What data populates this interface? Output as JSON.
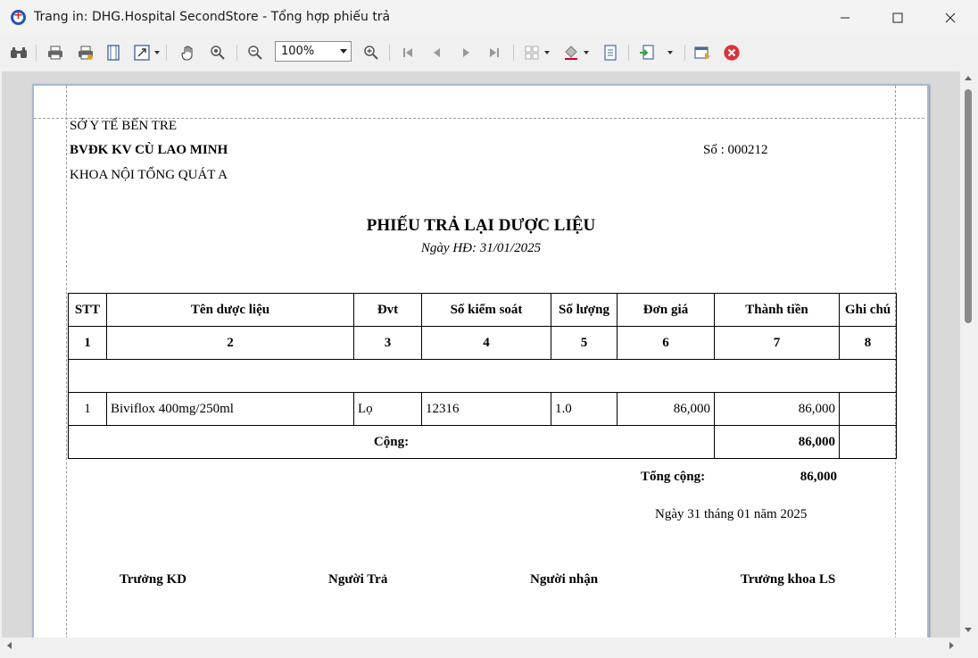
{
  "window": {
    "title": "Trang in: DHG.Hospital SecondStore - Tổng hợp phiếu trả"
  },
  "toolbar": {
    "zoom_value": "100%"
  },
  "report": {
    "org_line1": "SỞ Y TẾ BẾN TRE",
    "org_line2": "BVĐK KV CÙ LAO MINH",
    "org_line3": "KHOA NỘI TỔNG QUÁT A",
    "number_label": "Số : 000212",
    "title": "PHIẾU TRẢ LẠI DƯỢC LIỆU",
    "date_line": "Ngày HĐ: 31/01/2025",
    "columns": [
      "STT",
      "Tên dược liệu",
      "Đvt",
      "Số kiểm soát",
      "Số lượng",
      "Đơn giá",
      "Thành tiền",
      "Ghi chú"
    ],
    "column_numbers": [
      "1",
      "2",
      "3",
      "4",
      "5",
      "6",
      "7",
      "8"
    ],
    "rows": [
      {
        "stt": "1",
        "name": "Biviflox 400mg/250ml",
        "unit": "Lọ",
        "control_no": "12316",
        "quantity": "1.0",
        "unit_price": "86,000",
        "amount": "86,000",
        "note": ""
      }
    ],
    "subtotal_label": "Cộng:",
    "subtotal_value": "86,000",
    "total_label": "Tổng cộng:",
    "total_value": "86,000",
    "sign_date": "Ngày 31 tháng 01 năm 2025",
    "signers": [
      "Trưởng KD",
      "Người Trả",
      "Người nhận",
      "Trưởng khoa LS"
    ]
  }
}
